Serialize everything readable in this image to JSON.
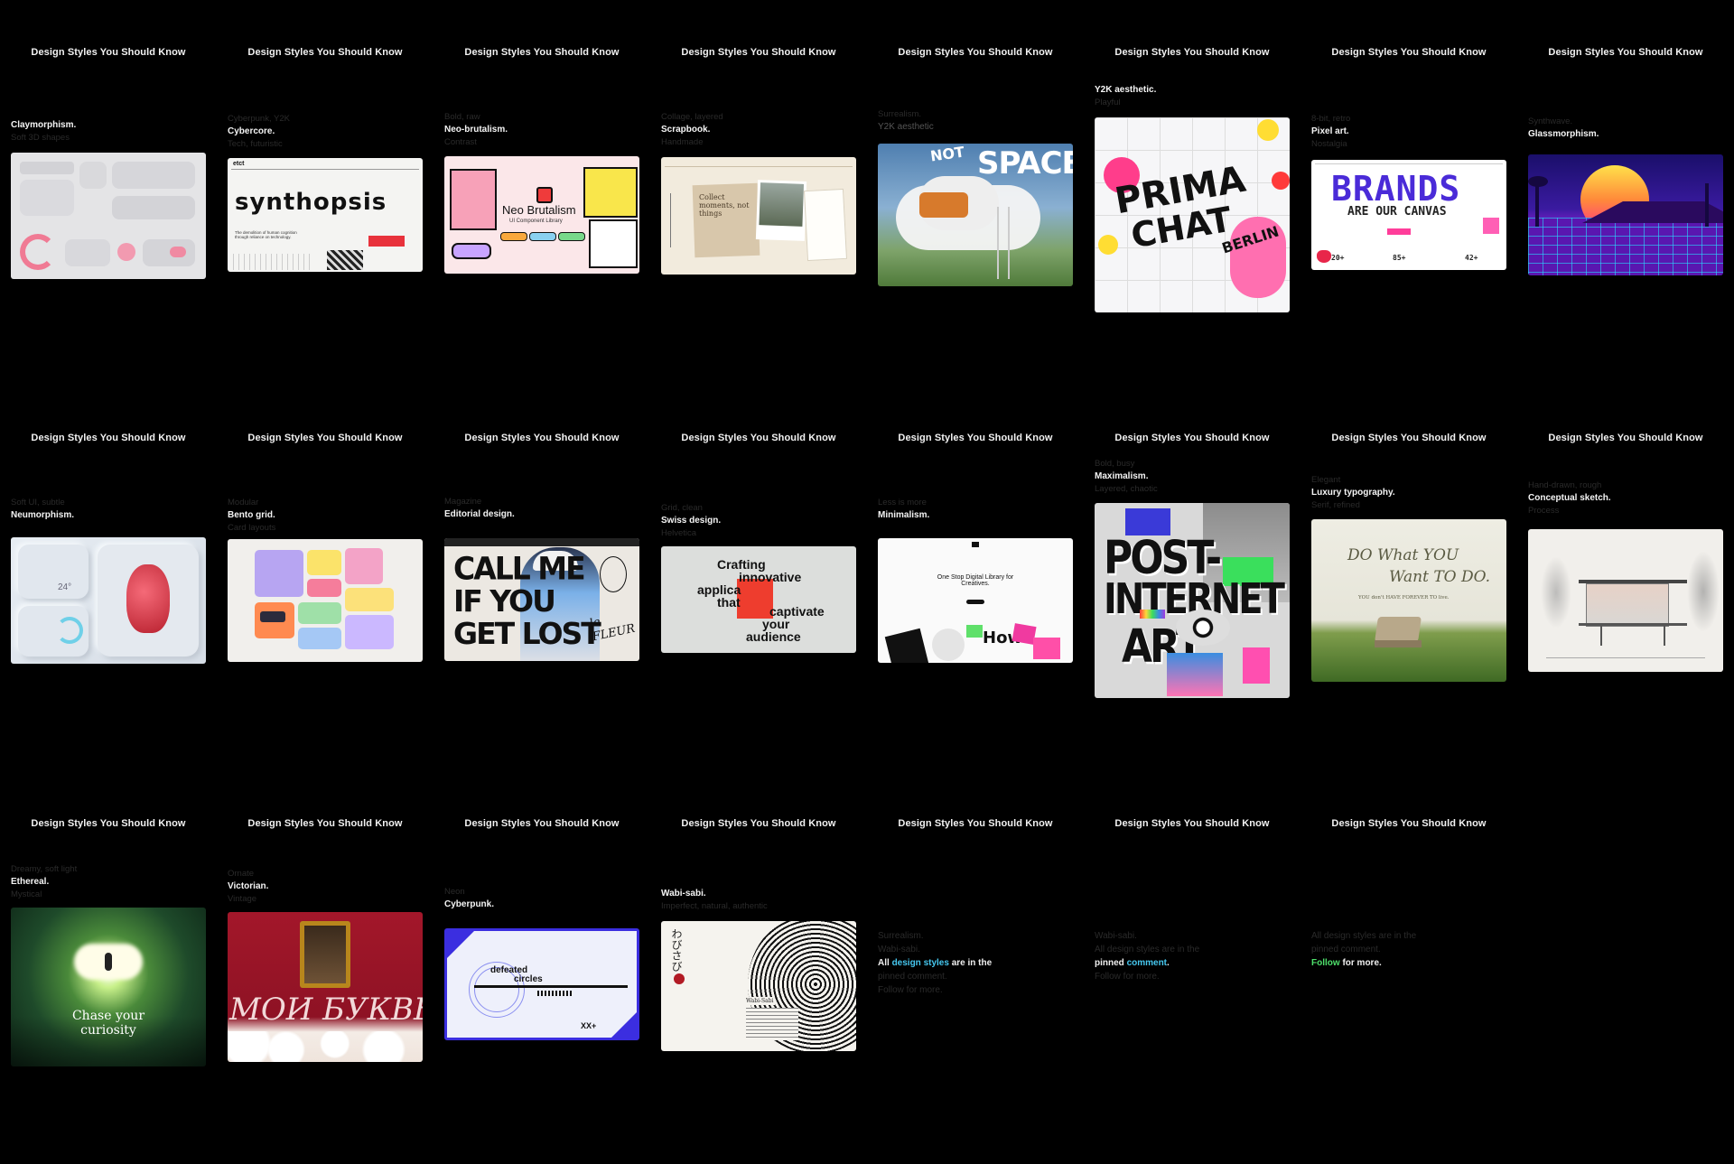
{
  "series_title": "Design Styles You Should Know",
  "frames": [
    {
      "label": "Claymorphism.",
      "ghost_above": "",
      "ghost_below": "Soft 3D shapes"
    },
    {
      "label": "Cybercore.",
      "ghost_above": "Cyberpunk, Y2K",
      "ghost_below": "Tech, futuristic"
    },
    {
      "label": "Neo-brutalism.",
      "ghost_above": "Bold, raw",
      "ghost_below": "Contrast"
    },
    {
      "label": "Scrapbook.",
      "ghost_above": "Collage, layered",
      "ghost_below": "Handmade"
    },
    {
      "label": "Y2K aesthetic",
      "ghost_above": "Surrealism.",
      "ghost_below": ""
    },
    {
      "label": "Y2K aesthetic.",
      "ghost_above": "",
      "ghost_below": "Playful"
    },
    {
      "label": "Pixel art.",
      "ghost_above": "8-bit, retro",
      "ghost_below": "Nostalgia"
    },
    {
      "label": "Glassmorphism.",
      "ghost_above": "Synthwave.",
      "ghost_below": ""
    },
    {
      "label": "Neumorphism.",
      "ghost_above": "Soft UI, subtle",
      "ghost_below": ""
    },
    {
      "label": "Bento grid.",
      "ghost_above": "Modular",
      "ghost_below": "Card layouts"
    },
    {
      "label": "Editorial design.",
      "ghost_above": "Magazine",
      "ghost_below": ""
    },
    {
      "label": "Swiss design.",
      "ghost_above": "Grid, clean",
      "ghost_below": "Helvetica"
    },
    {
      "label": "Minimalism.",
      "ghost_above": "Less is more",
      "ghost_below": ""
    },
    {
      "label": "Maximalism.",
      "ghost_above": "Bold, busy",
      "ghost_below": "Layered, chaotic"
    },
    {
      "label": "Luxury typography.",
      "ghost_above": "Elegant",
      "ghost_below": "Serif, refined"
    },
    {
      "label": "Conceptual sketch.",
      "ghost_above": "Hand-drawn, rough",
      "ghost_below": "Process"
    },
    {
      "label": "Ethereal.",
      "ghost_above": "Dreamy, soft light",
      "ghost_below": "Mystical"
    },
    {
      "label": "Victorian.",
      "ghost_above": "Ornate",
      "ghost_below": "Vintage"
    },
    {
      "label": "Cyberpunk.",
      "ghost_above": "Neon",
      "ghost_below": ""
    },
    {
      "label": "Wabi-sabi.",
      "ghost_above": "",
      "ghost_below": "Imperfect, natural, authentic"
    }
  ],
  "cards": {
    "claymorphism": {},
    "cybercore": {
      "brand": "synthopsis",
      "logo": "etct",
      "blurb": "The demolition of human cognition through reliance on technology."
    },
    "neobrutalism": {
      "title": "Neo Brutalism",
      "subtitle": "UI Component Library"
    },
    "scrapbook": {
      "note": "Collect moments, not things"
    },
    "surrealism": {
      "word1": "NOT",
      "word2": "SPACE"
    },
    "y2k": {
      "line1": "PRIMA",
      "line2": "CHAT",
      "line3": "BERLIN"
    },
    "pixel": {
      "line1": "BRANDS",
      "line2": "ARE OUR CANVAS",
      "stat1": "20+",
      "stat2": "85+",
      "stat3": "42+"
    },
    "synthwave": {},
    "neumorphism": {
      "temp": "24°"
    },
    "bento": {},
    "editorial": {
      "line1": "CALL ME",
      "line2": "IF YOU",
      "line3": "GET LOST",
      "tag": "le FLEUR"
    },
    "swiss": {
      "l1": "Crafting",
      "l2": "innovative",
      "l3": "applica",
      "l4": "that",
      "l5": "captivate",
      "l6": "your",
      "l7": "audience"
    },
    "minimalism": {
      "headline": "One Stop Digital Library for Creatives.",
      "footer": "How"
    },
    "maximalism": {
      "line1": "POST-",
      "line2": "INTERNET",
      "line3": "ART"
    },
    "luxury": {
      "line1": "DO What YOU",
      "line2": "Want TO DO.",
      "line3": "YOU don't HAVE FOREVER TO live."
    },
    "sketch": {},
    "ethereal": {
      "line1": "Chase your",
      "line2": "curiosity"
    },
    "victorian": {
      "word": "МОИ БУКВЫ"
    },
    "cyberpunk": {
      "text1": "defeated",
      "text2": "circles",
      "tag": "XX+"
    },
    "wabisabi": {
      "vertical": "わびさび",
      "name": "Wabi-Sabi"
    }
  },
  "end_frames": [
    {
      "ghost1": "Surrealism.",
      "ghost2": "Wabi-sabi.",
      "pre": "All ",
      "hl": "design styles",
      "post": " are in the",
      "ghost3": "pinned comment.",
      "ghost4": "Follow for more."
    },
    {
      "ghost1": "Wabi-sabi.",
      "ghost2": "All design styles are in the",
      "pre": "pinned ",
      "hl": "comment",
      "post": ".",
      "ghost3": "Follow for more.",
      "ghost4": ""
    },
    {
      "ghost1": "All design styles are in the",
      "ghost2": "pinned comment.",
      "pre": "",
      "hl": "Follow",
      "post": " for more.",
      "ghost3": "",
      "ghost4": ""
    }
  ],
  "colors": {
    "background": "#000000",
    "accent_cyan": "#46c8f0",
    "accent_green": "#4ee06b"
  }
}
